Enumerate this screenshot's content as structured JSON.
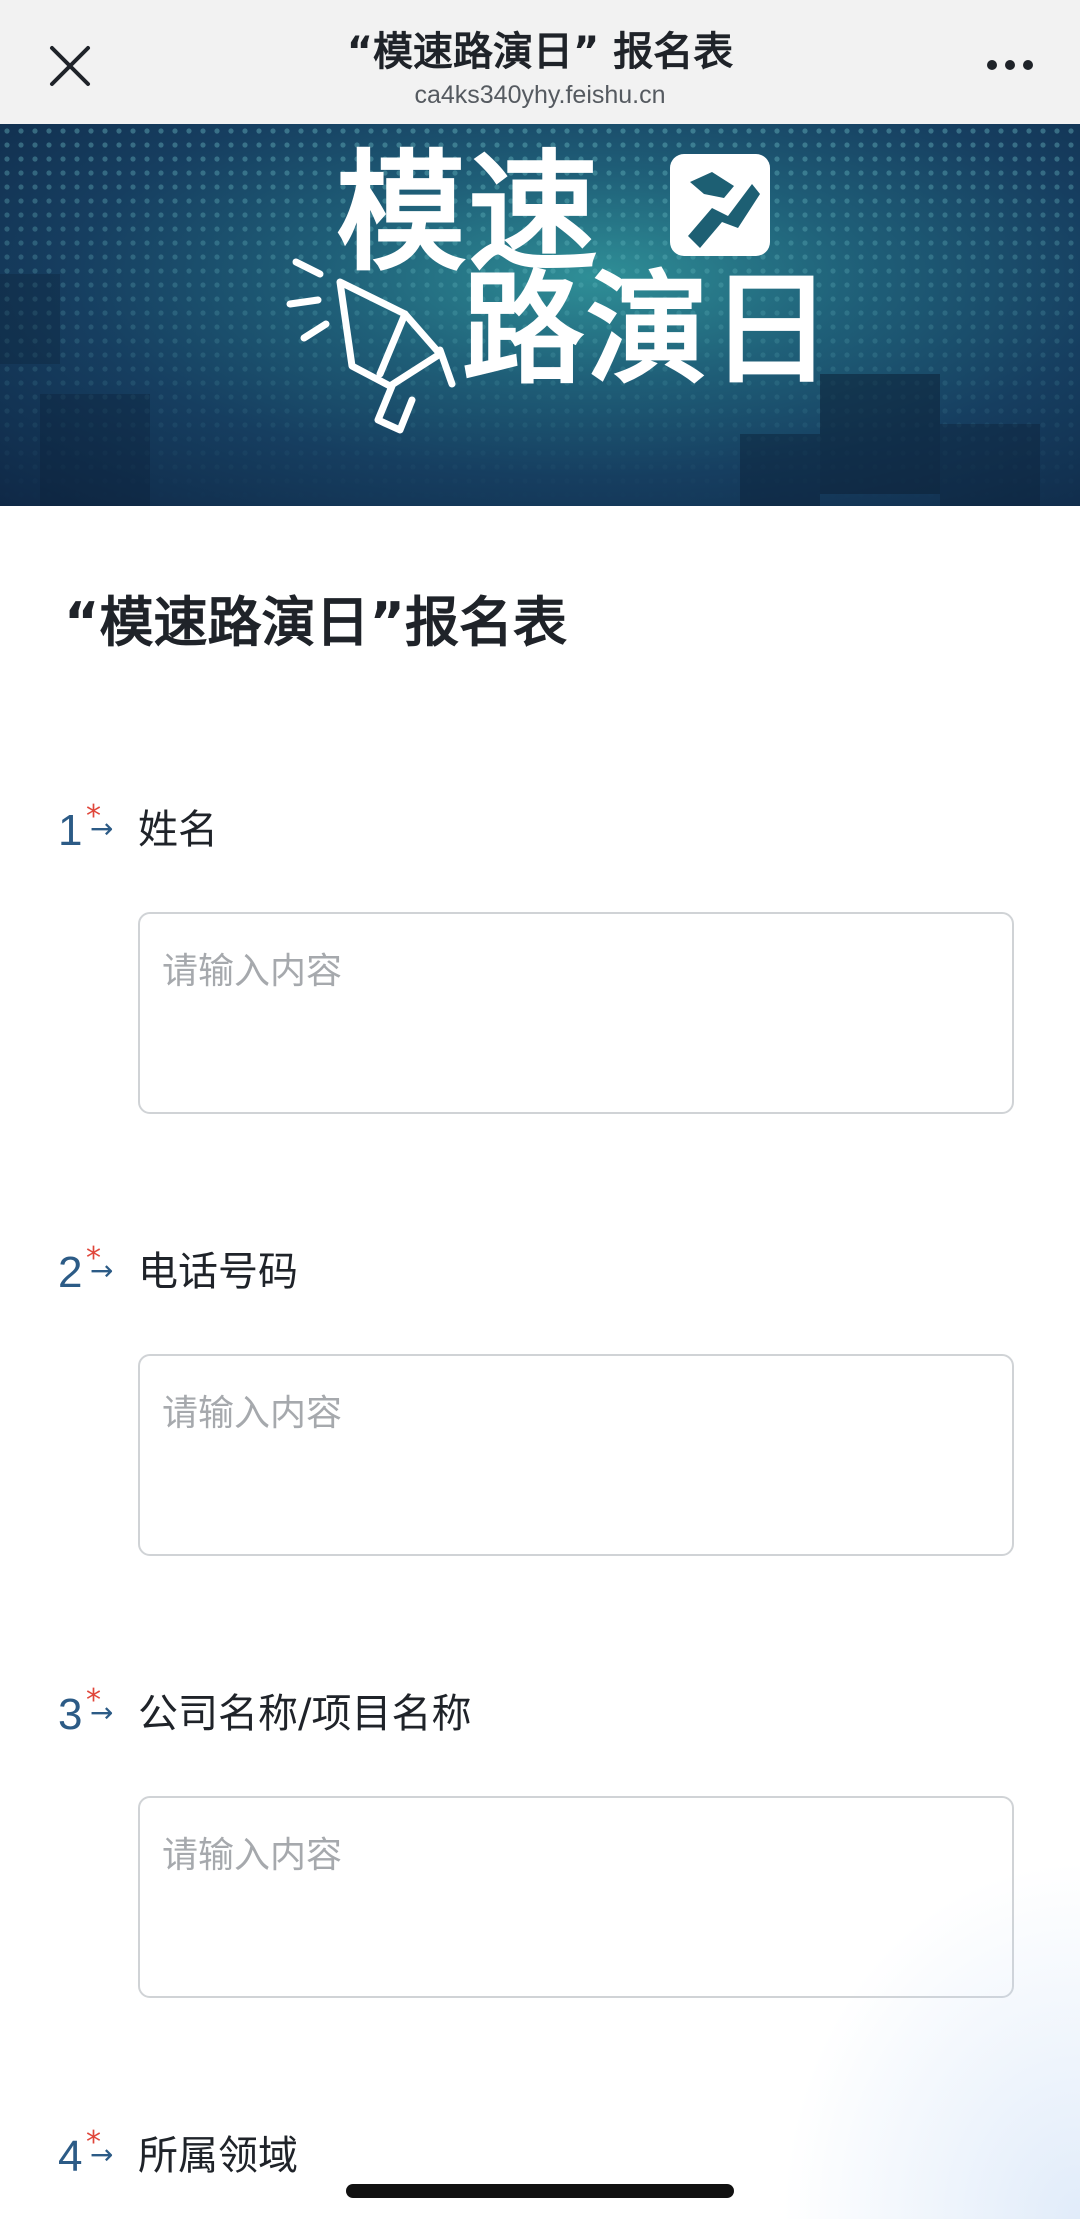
{
  "nav": {
    "title": "“模速路演日” 报名表",
    "url": "ca4ks340yhy.feishu.cn"
  },
  "banner": {
    "line1": "模速",
    "line2": "路演日",
    "icons": [
      "megaphone-icon",
      "handshake-icon"
    ]
  },
  "form": {
    "title": "“模速路演日”报名表",
    "questions": [
      {
        "number": "1",
        "required": "*",
        "arrow": "→",
        "label": "姓名",
        "placeholder": "请输入内容"
      },
      {
        "number": "2",
        "required": "*",
        "arrow": "→",
        "label": "电话号码",
        "placeholder": "请输入内容"
      },
      {
        "number": "3",
        "required": "*",
        "arrow": "→",
        "label": "公司名称/项目名称",
        "placeholder": "请输入内容"
      },
      {
        "number": "4",
        "required": "*",
        "arrow": "→",
        "label": "所属领域"
      }
    ]
  },
  "colors": {
    "accent_number": "#2c5b86",
    "required_star": "#e0463a",
    "nav_background": "#f2f2f2",
    "input_border": "#d0d3d6"
  }
}
